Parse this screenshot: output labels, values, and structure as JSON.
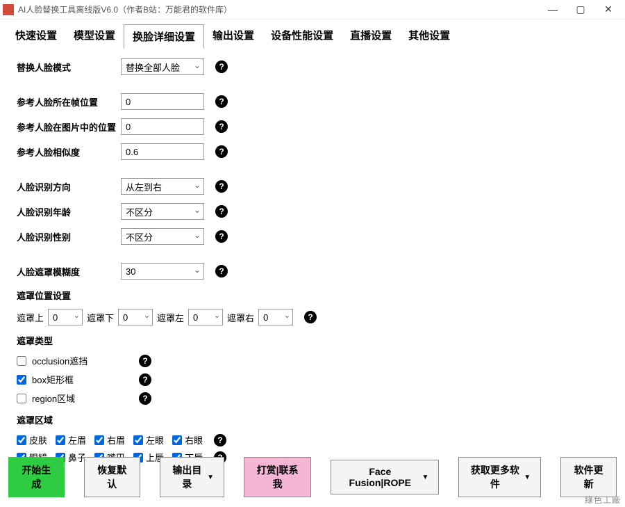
{
  "window": {
    "title": "AI人脸替换工具离线版V6.0（作者B站：万能君的软件库）"
  },
  "tabs": [
    "快速设置",
    "模型设置",
    "换脸详细设置",
    "输出设置",
    "设备性能设置",
    "直播设置",
    "其他设置"
  ],
  "form": {
    "replace_mode_label": "替换人脸模式",
    "replace_mode_value": "替换全部人脸",
    "ref_frame_label": "参考人脸所在帧位置",
    "ref_frame_value": "0",
    "ref_img_pos_label": "参考人脸在图片中的位置",
    "ref_img_pos_value": "0",
    "ref_similarity_label": "参考人脸相似度",
    "ref_similarity_value": "0.6",
    "detect_dir_label": "人脸识别方向",
    "detect_dir_value": "从左到右",
    "detect_age_label": "人脸识别年龄",
    "detect_age_value": "不区分",
    "detect_gender_label": "人脸识别性别",
    "detect_gender_value": "不区分",
    "mask_blur_label": "人脸遮罩模糊度",
    "mask_blur_value": "30"
  },
  "mask_pos": {
    "title": "遮罩位置设置",
    "up_label": "遮罩上",
    "up_value": "0",
    "down_label": "遮罩下",
    "down_value": "0",
    "left_label": "遮罩左",
    "left_value": "0",
    "right_label": "遮罩右",
    "right_value": "0"
  },
  "mask_type": {
    "title": "遮罩类型",
    "occlusion": "occlusion遮挡",
    "box": "box矩形框",
    "region": "region区域"
  },
  "mask_region": {
    "title": "遮罩区域",
    "items_row1": [
      "皮肤",
      "左眉",
      "右眉",
      "左眼",
      "右眼"
    ],
    "items_row2": [
      "眼镜",
      "鼻子",
      "嘴巴",
      "上唇",
      "下唇"
    ]
  },
  "footer": {
    "start": "开始生成",
    "restore": "恢复默认",
    "output_dir": "输出目录",
    "donate": "打赏|联系我",
    "ff_rope": "Face Fusion|ROPE",
    "more_sw": "获取更多软件",
    "update": "软件更新"
  },
  "watermark": "綠色工廠",
  "help_glyph": "?"
}
